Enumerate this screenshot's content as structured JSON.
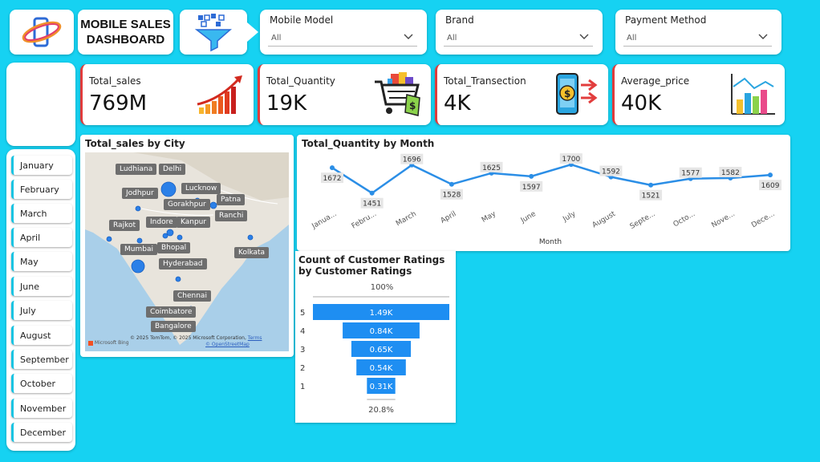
{
  "header": {
    "title_line1": "MOBILE SALES",
    "title_line2": "DASHBOARD"
  },
  "filters": [
    {
      "label": "Mobile Model",
      "value": "All"
    },
    {
      "label": "Brand",
      "value": "All"
    },
    {
      "label": "Payment Method",
      "value": "All"
    }
  ],
  "kpis": [
    {
      "label": "Total_sales",
      "value": "769M",
      "icon": "bar-chart-growth-icon"
    },
    {
      "label": "Total_Quantity",
      "value": "19K",
      "icon": "shopping-cart-icon"
    },
    {
      "label": "Total_Transection",
      "value": "4K",
      "icon": "mobile-payment-icon"
    },
    {
      "label": "Average_price",
      "value": "40K",
      "icon": "bar-chart-icon"
    }
  ],
  "months": [
    "January",
    "February",
    "March",
    "April",
    "May",
    "June",
    "July",
    "August",
    "September",
    "October",
    "November",
    "December"
  ],
  "map": {
    "title": "Total_sales by City",
    "cities": [
      "Ludhiana",
      "Delhi",
      "Jodhpur",
      "Lucknow",
      "Gorakhpur",
      "Patna",
      "Ranchi",
      "Rajkot",
      "Indore",
      "Kanpur",
      "Bhopal",
      "Mumbai",
      "Hyderabad",
      "Kolkata",
      "Chennai",
      "Coimbatore",
      "Bangalore"
    ],
    "attribution": "© 2025 TomTom, © 2025 Microsoft Corporation,",
    "terms": "Terms",
    "osm": "© OpenStreetMap",
    "bing": "Microsoft Bing"
  },
  "chart_data": [
    {
      "type": "line",
      "title": "Total_Quantity by Month",
      "xlabel": "Month",
      "ylabel": "",
      "categories": [
        "Janua...",
        "Febru...",
        "March",
        "April",
        "May",
        "June",
        "July",
        "August",
        "Septe...",
        "Octo...",
        "Nove...",
        "Dece..."
      ],
      "values": [
        1672,
        1451,
        1696,
        1528,
        1625,
        1597,
        1700,
        1592,
        1521,
        1577,
        1582,
        1609
      ],
      "ylim": [
        1400,
        1750
      ],
      "color": "#2b8ee6"
    },
    {
      "type": "bar",
      "title": "Count of Customer Ratings by Customer Ratings",
      "categories": [
        "5",
        "4",
        "3",
        "2",
        "1"
      ],
      "values": [
        1490,
        840,
        650,
        540,
        310
      ],
      "data_labels": [
        "1.49K",
        "0.84K",
        "0.65K",
        "0.54K",
        "0.31K"
      ],
      "top_percent": "100%",
      "bottom_percent": "20.8%",
      "color": "#1e8ef2"
    }
  ]
}
